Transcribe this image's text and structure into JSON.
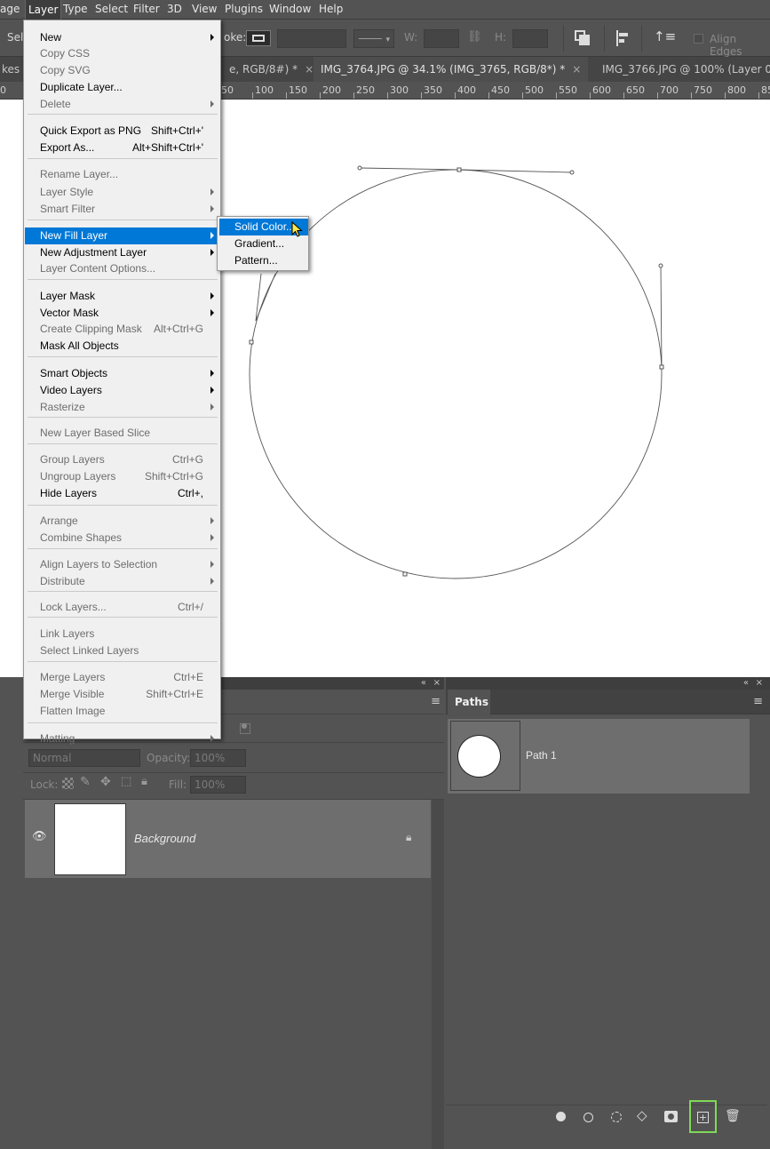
{
  "menubar": {
    "items": [
      "age",
      "Layer",
      "Type",
      "Select",
      "Filter",
      "3D",
      "View",
      "Plugins",
      "Window",
      "Help"
    ]
  },
  "options": {
    "sel_partial": "Sel",
    "stroke_label": "oke:",
    "w_label": "W:",
    "h_label": "H:",
    "align_edges": "Align Edges"
  },
  "tabs": [
    {
      "label": "kes",
      "close": ""
    },
    {
      "label": "e, RGB/8#) *",
      "close": "×"
    },
    {
      "label": "IMG_3764.JPG @ 34.1% (IMG_3765, RGB/8*) *",
      "close": "×"
    },
    {
      "label": "IMG_3766.JPG @ 100% (Layer 0",
      "close": ""
    }
  ],
  "ruler": [
    "0",
    "50",
    "100",
    "150",
    "200",
    "250",
    "300",
    "350",
    "400",
    "450",
    "500",
    "550",
    "600",
    "650",
    "700",
    "750",
    "800",
    "85"
  ],
  "layer_menu": {
    "items": [
      {
        "label": "New",
        "shortcut": "",
        "submenu": true,
        "disabled": false
      },
      {
        "label": "Copy CSS",
        "shortcut": "",
        "submenu": false,
        "disabled": true
      },
      {
        "label": "Copy SVG",
        "shortcut": "",
        "submenu": false,
        "disabled": true
      },
      {
        "label": "Duplicate Layer...",
        "shortcut": "",
        "submenu": false,
        "disabled": false
      },
      {
        "label": "Delete",
        "shortcut": "",
        "submenu": true,
        "disabled": true
      },
      {
        "label": "Quick Export as PNG",
        "shortcut": "Shift+Ctrl+'",
        "submenu": false,
        "disabled": false
      },
      {
        "label": "Export As...",
        "shortcut": "Alt+Shift+Ctrl+'",
        "submenu": false,
        "disabled": false
      },
      {
        "label": "Rename Layer...",
        "shortcut": "",
        "submenu": false,
        "disabled": true
      },
      {
        "label": "Layer Style",
        "shortcut": "",
        "submenu": true,
        "disabled": true
      },
      {
        "label": "Smart Filter",
        "shortcut": "",
        "submenu": true,
        "disabled": true
      },
      {
        "label": "New Fill Layer",
        "shortcut": "",
        "submenu": true,
        "disabled": false,
        "highlighted": true
      },
      {
        "label": "New Adjustment Layer",
        "shortcut": "",
        "submenu": true,
        "disabled": false
      },
      {
        "label": "Layer Content Options...",
        "shortcut": "",
        "submenu": false,
        "disabled": true
      },
      {
        "label": "Layer Mask",
        "shortcut": "",
        "submenu": true,
        "disabled": false
      },
      {
        "label": "Vector Mask",
        "shortcut": "",
        "submenu": true,
        "disabled": false
      },
      {
        "label": "Create Clipping Mask",
        "shortcut": "Alt+Ctrl+G",
        "submenu": false,
        "disabled": true
      },
      {
        "label": "Mask All Objects",
        "shortcut": "",
        "submenu": false,
        "disabled": false
      },
      {
        "label": "Smart Objects",
        "shortcut": "",
        "submenu": true,
        "disabled": false
      },
      {
        "label": "Video Layers",
        "shortcut": "",
        "submenu": true,
        "disabled": false
      },
      {
        "label": "Rasterize",
        "shortcut": "",
        "submenu": true,
        "disabled": true
      },
      {
        "label": "New Layer Based Slice",
        "shortcut": "",
        "submenu": false,
        "disabled": true
      },
      {
        "label": "Group Layers",
        "shortcut": "Ctrl+G",
        "submenu": false,
        "disabled": true
      },
      {
        "label": "Ungroup Layers",
        "shortcut": "Shift+Ctrl+G",
        "submenu": false,
        "disabled": true
      },
      {
        "label": "Hide Layers",
        "shortcut": "Ctrl+,",
        "submenu": false,
        "disabled": false
      },
      {
        "label": "Arrange",
        "shortcut": "",
        "submenu": true,
        "disabled": true
      },
      {
        "label": "Combine Shapes",
        "shortcut": "",
        "submenu": true,
        "disabled": true
      },
      {
        "label": "Align Layers to Selection",
        "shortcut": "",
        "submenu": true,
        "disabled": true
      },
      {
        "label": "Distribute",
        "shortcut": "",
        "submenu": true,
        "disabled": true
      },
      {
        "label": "Lock Layers...",
        "shortcut": "Ctrl+/",
        "submenu": false,
        "disabled": true
      },
      {
        "label": "Link Layers",
        "shortcut": "",
        "submenu": false,
        "disabled": true
      },
      {
        "label": "Select Linked Layers",
        "shortcut": "",
        "submenu": false,
        "disabled": true
      },
      {
        "label": "Merge Layers",
        "shortcut": "Ctrl+E",
        "submenu": false,
        "disabled": true
      },
      {
        "label": "Merge Visible",
        "shortcut": "Shift+Ctrl+E",
        "submenu": false,
        "disabled": true
      },
      {
        "label": "Flatten Image",
        "shortcut": "",
        "submenu": false,
        "disabled": true
      },
      {
        "label": "Matting",
        "shortcut": "",
        "submenu": true,
        "disabled": true
      }
    ]
  },
  "fill_submenu": {
    "items": [
      {
        "label": "Solid Color...",
        "highlighted": true
      },
      {
        "label": "Gradient...",
        "highlighted": false
      },
      {
        "label": "Pattern...",
        "highlighted": false
      }
    ]
  },
  "layers_panel": {
    "blend_mode": "Normal",
    "opacity_label": "Opacity:",
    "opacity_value": "100%",
    "lock_label": "Lock:",
    "fill_label": "Fill:",
    "fill_value": "100%",
    "layer_name": "Background"
  },
  "paths_panel": {
    "tab_label": "Paths",
    "path_name": "Path 1"
  },
  "colors": {
    "menu_highlight": "#0078d7",
    "panel_bg": "#535353",
    "new_path_outline": "#7ed957"
  }
}
